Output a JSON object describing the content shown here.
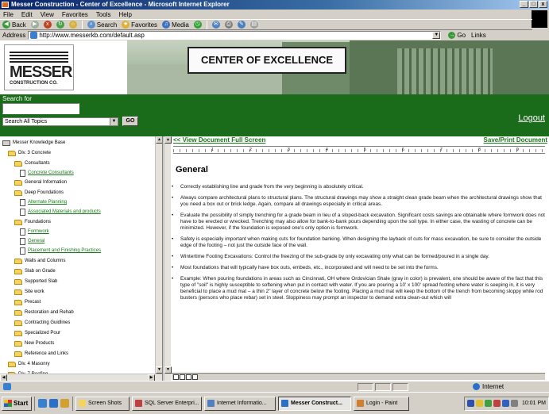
{
  "window": {
    "title": "Messer Construction - Center of Excellence - Microsoft Internet Explorer",
    "controls": [
      "_",
      "□",
      "x"
    ]
  },
  "menu": [
    "File",
    "Edit",
    "View",
    "Favorites",
    "Tools",
    "Help"
  ],
  "toolbar": {
    "back": "Back",
    "search": "Search",
    "favorites": "Favorites",
    "media": "Media"
  },
  "address": {
    "label": "Address",
    "url": "http://www.messerkb.com/default.asp",
    "go": "Go",
    "links": "Links"
  },
  "header": {
    "logo_main": "MESSER",
    "logo_sub": "CONSTRUCTION CO.",
    "banner": "CENTER OF EXCELLENCE"
  },
  "site": {
    "search_label": "Search for",
    "search_value": "",
    "scope": "Search All Topics",
    "go_button": "GO",
    "logout": "Logout"
  },
  "tree": [
    {
      "label": "Messer Knowledge Base",
      "type": "root"
    },
    {
      "label": "Div. 3 Concrete",
      "type": "folder"
    },
    {
      "label": "Consultants",
      "type": "folder"
    },
    {
      "label": "Concrete Consultants",
      "type": "doc"
    },
    {
      "label": "General Information",
      "type": "folder"
    },
    {
      "label": "Deep Foundations",
      "type": "folder"
    },
    {
      "label": "Alternate Planning",
      "type": "doc"
    },
    {
      "label": "Associated Materials and products",
      "type": "doc"
    },
    {
      "label": "Foundations",
      "type": "folder"
    },
    {
      "label": "Formwork",
      "type": "doc"
    },
    {
      "label": "General",
      "type": "doc"
    },
    {
      "label": "Placement and Finishing Practices",
      "type": "doc"
    },
    {
      "label": "Walls and Columns",
      "type": "folder"
    },
    {
      "label": "Slab on Grade",
      "type": "folder"
    },
    {
      "label": "Supported Slab",
      "type": "folder"
    },
    {
      "label": "Site work",
      "type": "folder"
    },
    {
      "label": "Precast",
      "type": "folder"
    },
    {
      "label": "Restoration and Rehab",
      "type": "folder"
    },
    {
      "label": "Contracting Guidlines",
      "type": "folder"
    },
    {
      "label": "Specialized Pour",
      "type": "folder"
    },
    {
      "label": "New Products",
      "type": "folder"
    },
    {
      "label": "Reference and Links",
      "type": "folder"
    },
    {
      "label": "Div. 4 Masonry",
      "type": "folder"
    },
    {
      "label": "Div. 7 Roofing",
      "type": "folder"
    }
  ],
  "document": {
    "view_full": "<< View Document Full Screen",
    "save_print": "Save/Print Document",
    "ruler_numbers": [
      "1",
      "2",
      "3",
      "4",
      "5",
      "6",
      "7",
      "8",
      "9"
    ],
    "title": "General",
    "bullets": [
      "Correctly establishing line and grade from the very beginning is absolutely critical.",
      "Always compare architectural plans to structural plans.  The structural drawings may show a straight clean grade beam when the architectural drawings show that you need a box out or brick ledge.  Again, compare all drawings especially in critical areas.",
      "Evaluate the possibility of simply trenching for a grade beam in lieu of a sloped-back excavation.  Significant costs savings are obtainable where formwork does not have to be erected or wrecked.  Trenching may also allow for bank-to-bank pours depending upon the soil type.  In either case, the wasting of concrete can be minimized.  However, if the foundation is exposed one's only option is formwork.",
      "Safety is especially important when making cuts for foundation banking.  When designing the layback of cuts for mass excavation, be sure to consider the outside edge of the footing – not just the outside face of the wall.",
      "Wintertime Footing Excavations:  Control the freezing of the sub-grade by only excavating only what can be formed/poured in a single day.",
      "Most foundations that will typically have box outs, embeds, etc., incorporated and will need to be set into the forms.",
      "Example:  When pouring foundations in areas such as Cincinnati, OH where Ordovician Shale (gray in color) is prevalent, one should be aware of the fact that this type of \"soil\" is highly susceptible to softening when put in contact with water.  If you are pouring a 10' x 100' spread footing where water is seeping in, it is very beneficial to place a mud mat – a thin 2\" layer of concrete below the footing.  Placing a mud mat will keep the bottom of the trench from becoming sloppy while rod busters (persons who place rebar) set in steel.  Sloppiness may prompt an inspector to demand extra clean-out which will"
    ]
  },
  "status": {
    "zone": "Internet"
  },
  "taskbar": {
    "start": "Start",
    "tasks": [
      "Screen Shots",
      "SQL Server Enterpri...",
      "Internet Informatio...",
      "Messer Construct...",
      "Login - Paint"
    ],
    "clock": "10:01 PM"
  },
  "colors": {
    "site_green": "#1a6b1a",
    "link_green": "#1a7a1a",
    "titlebar": "#0a246a"
  }
}
